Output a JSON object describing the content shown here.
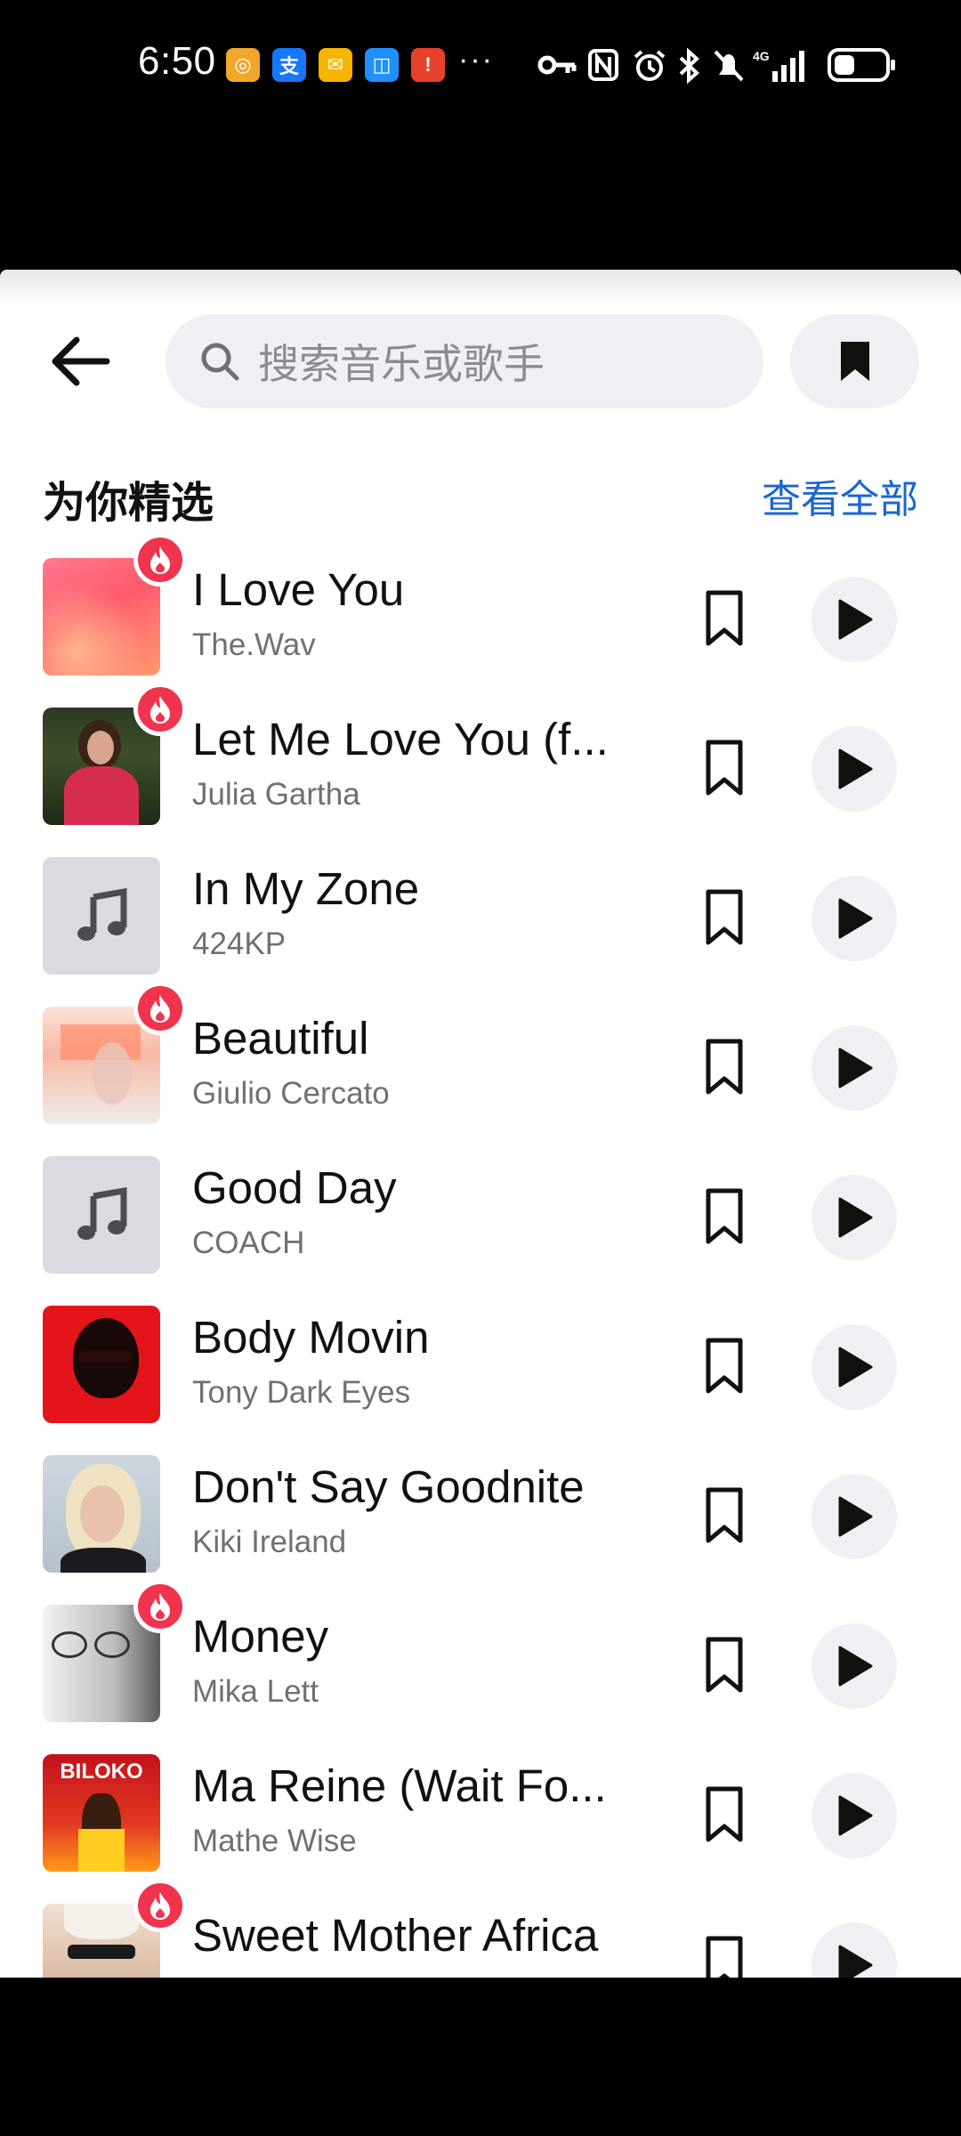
{
  "status_bar": {
    "time": "6:50",
    "notification_icons": [
      "keyring-app-icon",
      "alipay-icon",
      "mail-icon",
      "bag-app-icon",
      "alert-app-icon"
    ],
    "more": "···",
    "system_icons": [
      "key-icon",
      "nfc-icon",
      "alarm-icon",
      "bluetooth-icon",
      "mute-icon",
      "signal-4g-icon",
      "battery-icon"
    ],
    "network": "4G"
  },
  "header": {
    "search_placeholder": "搜索音乐或歌手"
  },
  "section": {
    "title": "为你精选",
    "view_all": "查看全部"
  },
  "songs": [
    {
      "title": "I Love You",
      "artist": "The.Wav",
      "hot": true,
      "cover": "pink-gradient"
    },
    {
      "title": "Let Me Love You (f...",
      "artist": "Julia Gartha",
      "hot": true,
      "cover": "woman-red-dress"
    },
    {
      "title": "In My Zone",
      "artist": "424KP",
      "hot": false,
      "cover": "generic"
    },
    {
      "title": "Beautiful",
      "artist": "Giulio Cercato",
      "hot": true,
      "cover": "pastel-portrait"
    },
    {
      "title": "Good Day",
      "artist": "COACH",
      "hot": false,
      "cover": "generic"
    },
    {
      "title": "Body Movin",
      "artist": "Tony Dark Eyes",
      "hot": false,
      "cover": "red-silhouette"
    },
    {
      "title": "Don't Say Goodnite",
      "artist": "Kiki Ireland",
      "hot": false,
      "cover": "blonde-portrait"
    },
    {
      "title": "Money",
      "artist": "Mika Lett",
      "hot": true,
      "cover": "bw-glasses"
    },
    {
      "title": "Ma Reine (Wait Fo...",
      "artist": "Mathe Wise",
      "hot": false,
      "cover": "biloko-poster",
      "cover_text": "BILOKO"
    },
    {
      "title": "Sweet Mother Africa",
      "artist": "",
      "hot": true,
      "cover": "sunglasses-portrait"
    }
  ],
  "colors": {
    "accent_link": "#1a66d1",
    "hot_badge": "#f0344e",
    "chip_bg": "#eff0f4",
    "secondary_text": "#6e7075"
  }
}
